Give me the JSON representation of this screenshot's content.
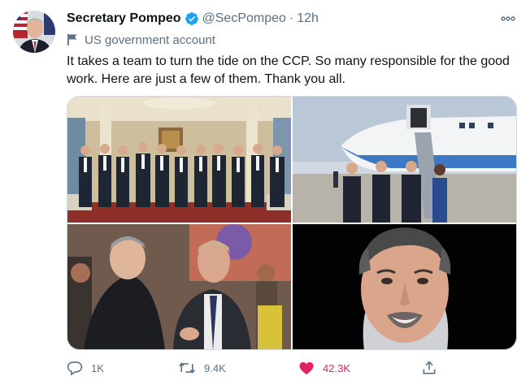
{
  "tweet": {
    "display_name": "Secretary Pompeo",
    "handle": "@SecPompeo",
    "separator": "·",
    "time": "12h",
    "account_label": "US government account",
    "text": "It takes a team to turn the tide on the CCP. So many responsible for the good work. Here are just a few of them. Thank you all.",
    "verified_icon": "verified-badge-icon",
    "more_icon": "more-options-icon"
  },
  "media": {
    "photos": [
      {
        "icon": "group-photo-ornate-room"
      },
      {
        "icon": "group-photo-airplane-tarmac"
      },
      {
        "icon": "photo-two-men-conversation"
      },
      {
        "icon": "portrait-man-smiling"
      }
    ]
  },
  "actions": {
    "reply_count": "1K",
    "retweet_count": "9.4K",
    "like_count": "42.3K",
    "like_color": "#e0245e",
    "muted_color": "#5b7083",
    "verified_color": "#1da1f2"
  }
}
